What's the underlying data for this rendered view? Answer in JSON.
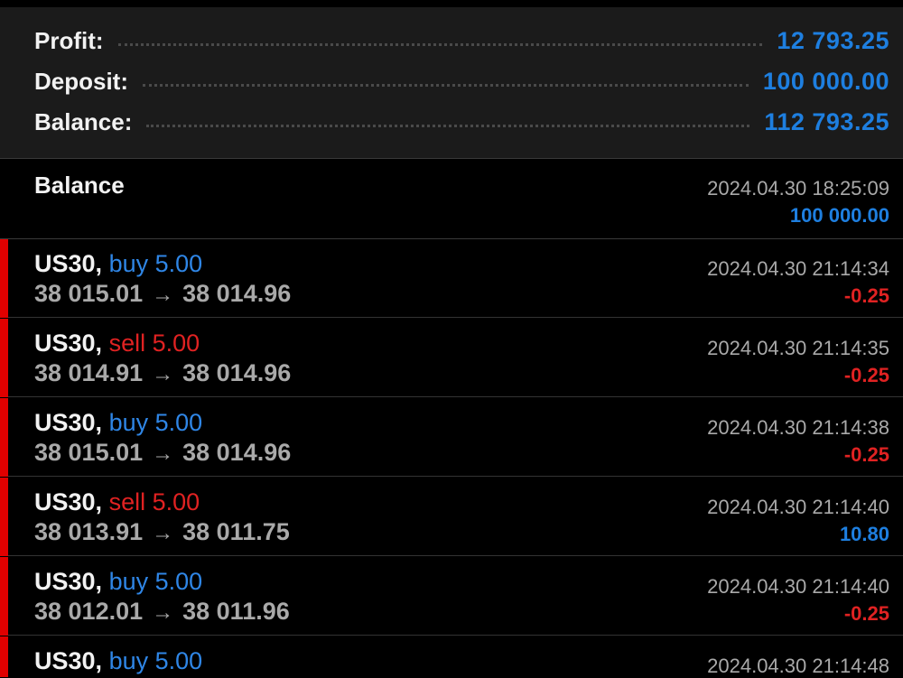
{
  "summary": {
    "profit_label": "Profit:",
    "profit_value": "12 793.25",
    "deposit_label": "Deposit:",
    "deposit_value": "100 000.00",
    "balance_label": "Balance:",
    "balance_value": "112 793.25"
  },
  "balance_entry": {
    "title": "Balance",
    "time": "2024.04.30 18:25:09",
    "amount": "100 000.00"
  },
  "deals": [
    {
      "symbol": "US30,",
      "direction": "buy",
      "volume": "5.00",
      "open_price": "38 015.01",
      "arrow": "→",
      "close_price": "38 014.96",
      "time": "2024.04.30 21:14:34",
      "profit": "-0.25"
    },
    {
      "symbol": "US30,",
      "direction": "sell",
      "volume": "5.00",
      "open_price": "38 014.91",
      "arrow": "→",
      "close_price": "38 014.96",
      "time": "2024.04.30 21:14:35",
      "profit": "-0.25"
    },
    {
      "symbol": "US30,",
      "direction": "buy",
      "volume": "5.00",
      "open_price": "38 015.01",
      "arrow": "→",
      "close_price": "38 014.96",
      "time": "2024.04.30 21:14:38",
      "profit": "-0.25"
    },
    {
      "symbol": "US30,",
      "direction": "sell",
      "volume": "5.00",
      "open_price": "38 013.91",
      "arrow": "→",
      "close_price": "38 011.75",
      "time": "2024.04.30 21:14:40",
      "profit": "10.80"
    },
    {
      "symbol": "US30,",
      "direction": "buy",
      "volume": "5.00",
      "open_price": "38 012.01",
      "arrow": "→",
      "close_price": "38 011.96",
      "time": "2024.04.30 21:14:40",
      "profit": "-0.25"
    },
    {
      "symbol": "US30,",
      "direction": "buy",
      "volume": "5.00",
      "time": "2024.04.30 21:14:48"
    }
  ],
  "colors": {
    "buy": "#2f86e6",
    "sell": "#e02222",
    "positive": "#1e7fe0",
    "negative": "#e02222",
    "marker": "#e00000"
  }
}
